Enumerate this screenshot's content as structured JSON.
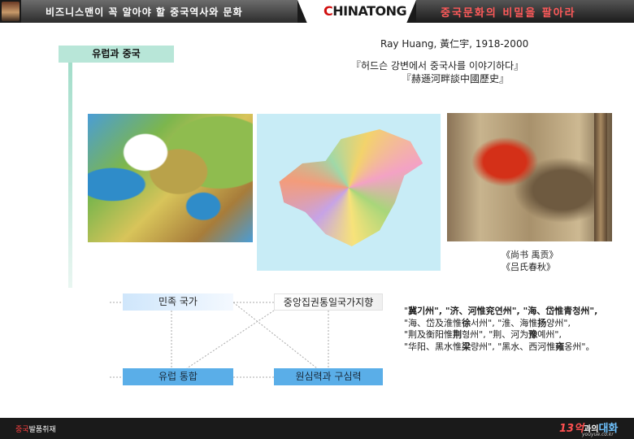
{
  "header": {
    "left_banner": "비즈니스맨이 꼭 알아야 할 중국역사와 문화",
    "logo_prefix": "C",
    "logo_text": "HINATONG",
    "right_banner": "중국문화의 비밀을 팔아라"
  },
  "section": {
    "title": "유럽과 중국"
  },
  "author": {
    "line": "Ray Huang, 黃仁宇, 1918-2000",
    "book_korean": "『허드슨 강변에서 중국사를 이야기하다』",
    "book_chinese": "『赫遜河畔談中國歷史』"
  },
  "images": {
    "europe_map": "europe-map",
    "china_map": "china-map",
    "ancient_scroll": "ancient-map-scroll"
  },
  "captions": {
    "line1": "《尚书 禹贡》",
    "line2": "《吕氏春秋》"
  },
  "diagram": {
    "nation_state": "민족 국가",
    "central_unity": "중앙집권통일국가지향",
    "europe_integration": "유럽 통합",
    "centrifugal_centripetal": "원심력과 구심력"
  },
  "provinces": {
    "l1a": "\"",
    "l1b": "冀",
    "l1c": "기州\", \"济、河惟",
    "l1d": "兖",
    "l1e": "연州\", \"海、岱惟",
    "l1f": "青",
    "l1g": "청州\",",
    "l2a": "\"海、岱及淮惟",
    "l2b": "徐",
    "l2c": "서州\", \"淮、海惟",
    "l2d": "扬",
    "l2e": "양州\",",
    "l3a": "\"荆及衡阳惟",
    "l3b": "荆",
    "l3c": "형州\", \"荆、河为",
    "l3d": "豫",
    "l3e": "예州\",",
    "l4a": "\"华阳、黑水惟",
    "l4b": "梁",
    "l4c": "량州\", \"黑水、西河惟",
    "l4d": "雍",
    "l4e": "옹州\"。"
  },
  "footer": {
    "left_red": "중국",
    "left_white": "발품취재",
    "right_num": "13억",
    "right_mid": "과의",
    "right_blue": "대화",
    "url": "youyue.co.kr"
  },
  "colors": {
    "header_bg": "#1a1a1a",
    "logo_red": "#d10f0f",
    "section_bg": "#b8e6d8",
    "box_blue": "#5aaee8",
    "box_light": "#cfe6fb"
  }
}
